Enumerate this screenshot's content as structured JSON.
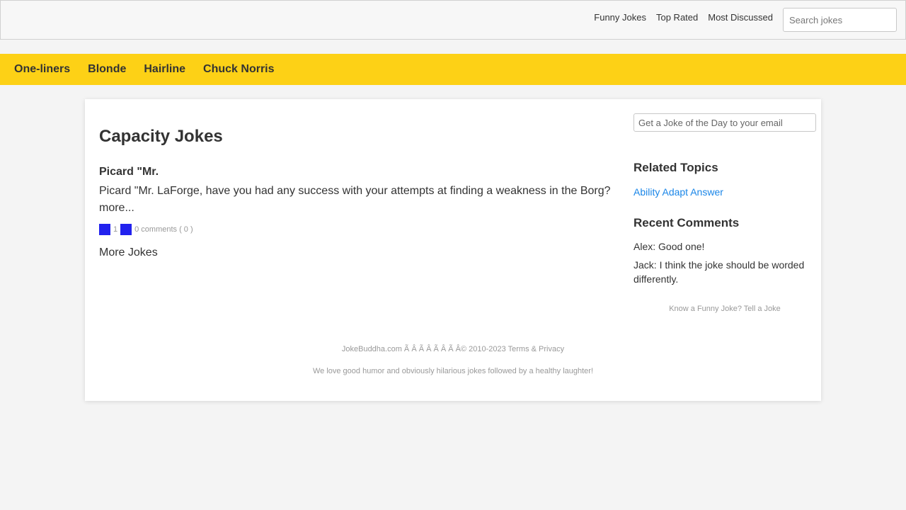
{
  "topbar": {
    "links": [
      "Funny Jokes",
      "Top Rated",
      "Most Discussed"
    ],
    "search_placeholder": "Search jokes"
  },
  "categories": [
    "One-liners",
    "Blonde",
    "Hairline",
    "Chuck Norris"
  ],
  "main": {
    "title": "Capacity Jokes",
    "joke": {
      "title": "Picard \"Mr.",
      "body": "Picard \"Mr. LaForge, have you had any success with your attempts at finding a weakness in the Borg? more...",
      "votes_up": "1",
      "comments": "0 comments ( 0 )"
    },
    "more_jokes": "More Jokes"
  },
  "sidebar": {
    "email_placeholder": "Get a Joke of the Day to your email",
    "related_heading": "Related Topics",
    "topics": [
      "Ability",
      "Adapt",
      "Answer"
    ],
    "comments_heading": "Recent Comments",
    "comments": [
      "Alex: Good one!",
      "Jack: I think the joke should be worded differently."
    ],
    "tell_joke": "Know a Funny Joke? Tell a Joke"
  },
  "footer": {
    "copyright": "JokeBuddha.com Ã   Â   Ã   Â   Ã   Â   Ã   Â© 2010-2023",
    "terms": "Terms & Privacy",
    "tagline": "We love good humor and obviously hilarious jokes followed by a healthy laughter!"
  },
  "colors": {
    "accent_yellow": "#fdd116",
    "link_blue": "#1a86e8",
    "vote_blue": "#2222ee"
  }
}
